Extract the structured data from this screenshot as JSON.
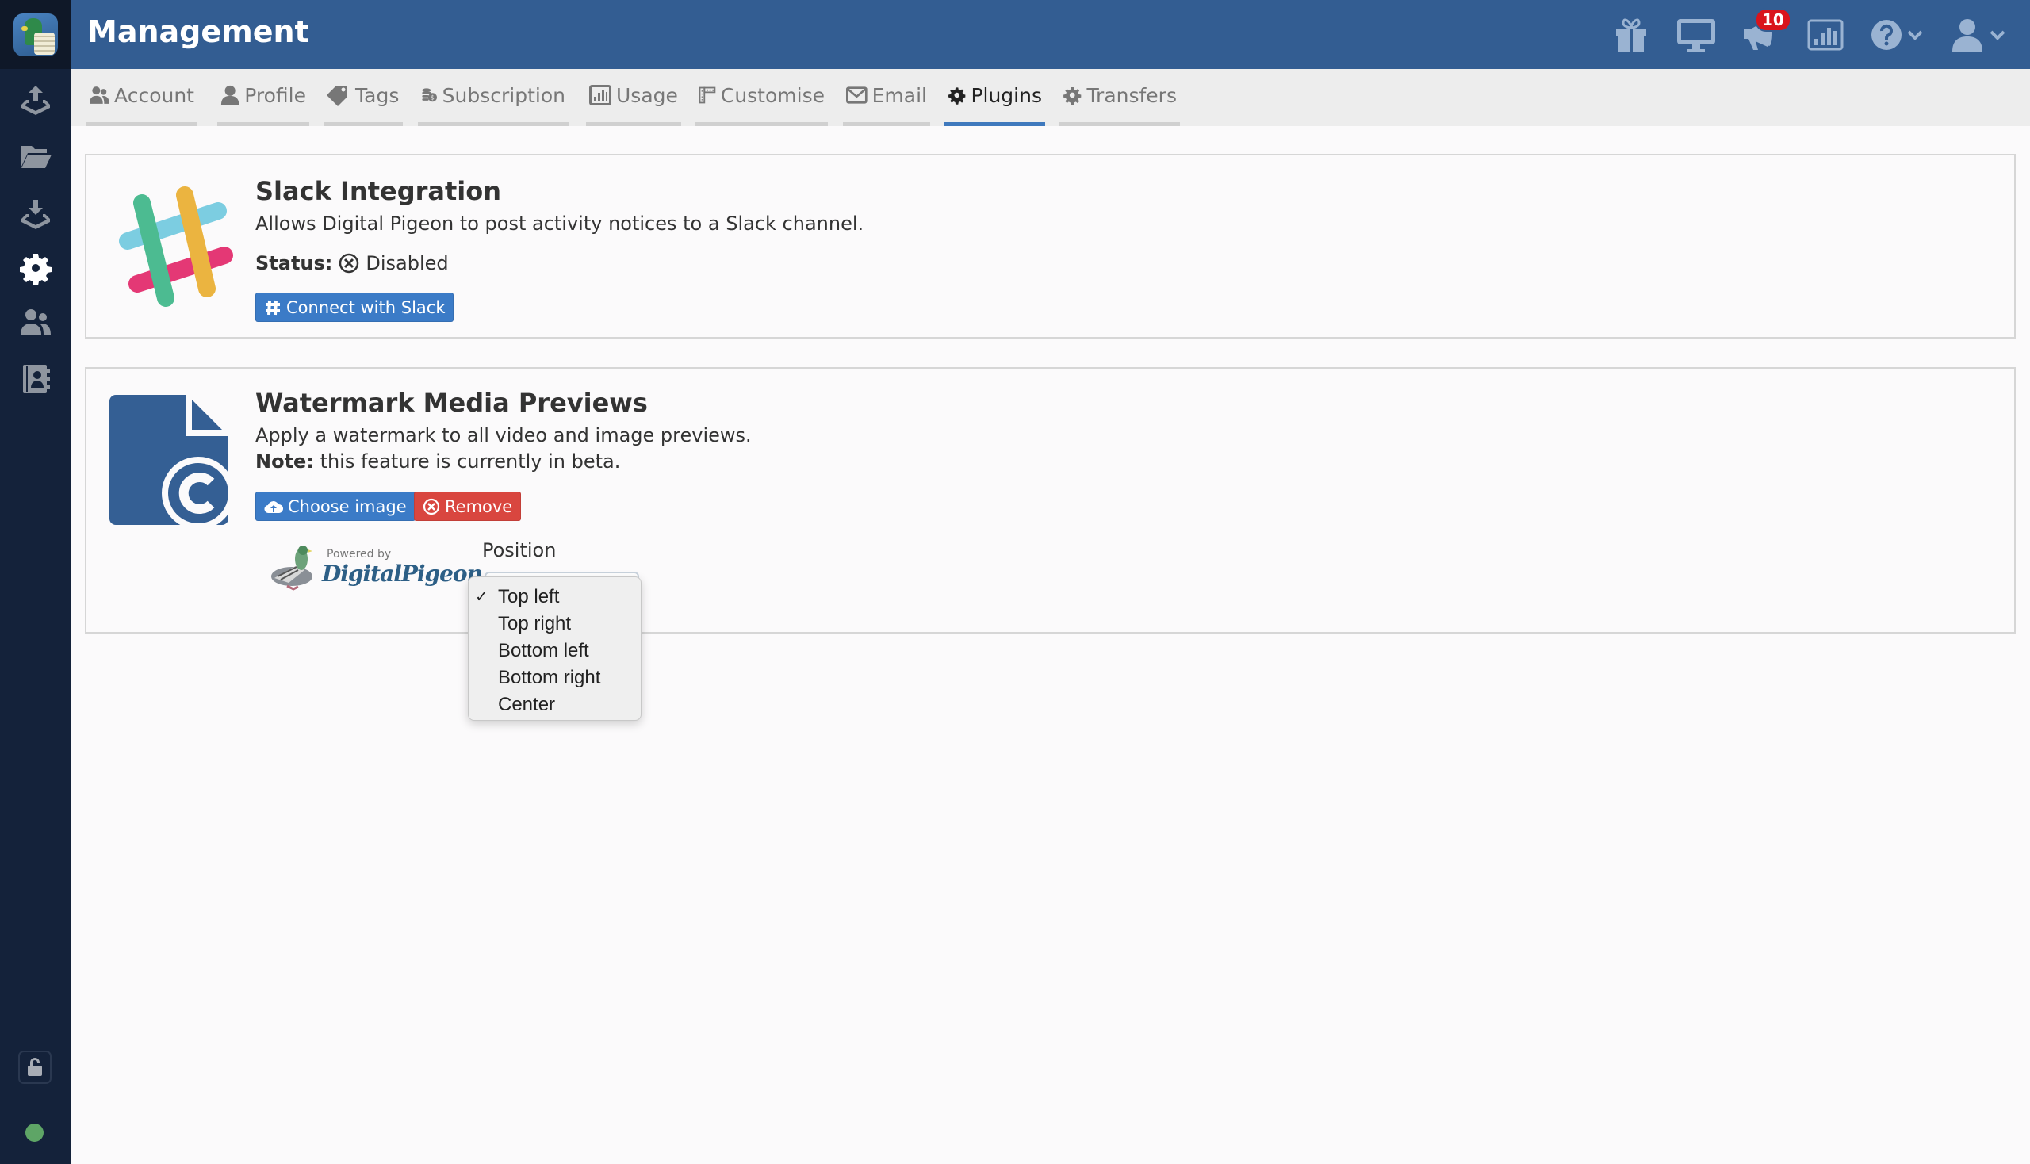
{
  "header": {
    "title": "Management",
    "notifications_count": "10",
    "icons": [
      "gift-icon",
      "monitor-icon",
      "megaphone-icon",
      "bar-chart-icon",
      "help-icon",
      "user-icon"
    ]
  },
  "sidebar": {
    "items": [
      {
        "name": "upload",
        "icon": "upload-tray-icon",
        "active": false
      },
      {
        "name": "files",
        "icon": "folder-open-icon",
        "active": false
      },
      {
        "name": "download",
        "icon": "download-tray-icon",
        "active": false
      },
      {
        "name": "settings",
        "icon": "gear-icon",
        "active": true
      },
      {
        "name": "users",
        "icon": "users-icon",
        "active": false
      },
      {
        "name": "contacts",
        "icon": "address-book-icon",
        "active": false
      }
    ],
    "lock_state": "unlocked",
    "status_color": "#5ea566"
  },
  "tabs": [
    {
      "label": "Account",
      "icon": "users-icon",
      "active": false
    },
    {
      "label": "Profile",
      "icon": "user-icon",
      "active": false
    },
    {
      "label": "Tags",
      "icon": "tag-icon",
      "active": false
    },
    {
      "label": "Subscription",
      "icon": "coins-icon",
      "active": false
    },
    {
      "label": "Usage",
      "icon": "bar-chart-icon",
      "active": false
    },
    {
      "label": "Customise",
      "icon": "ruler-icon",
      "active": false
    },
    {
      "label": "Email",
      "icon": "envelope-icon",
      "active": false
    },
    {
      "label": "Plugins",
      "icon": "gear-icon",
      "active": true
    },
    {
      "label": "Transfers",
      "icon": "gear-icon",
      "active": false
    }
  ],
  "plugins": {
    "slack": {
      "title": "Slack Integration",
      "description": "Allows Digital Pigeon to post activity notices to a Slack channel.",
      "status_label": "Status:",
      "status_value": "Disabled",
      "connect_label": "Connect with Slack"
    },
    "watermark": {
      "title": "Watermark Media Previews",
      "description": "Apply a watermark to all video and image previews.",
      "note_label": "Note:",
      "note_text": "this feature is currently in beta.",
      "choose_label": "Choose image",
      "remove_label": "Remove",
      "preview_powered": "Powered by",
      "preview_brand": "DigitalPigeon",
      "position_label": "Position",
      "position_options": [
        "Top left",
        "Top right",
        "Bottom left",
        "Bottom right",
        "Center"
      ],
      "position_selected": "Top left"
    }
  },
  "colors": {
    "header": "#335d92",
    "sidebar": "#14223a",
    "primary_button": "#3b7bc7",
    "danger_button": "#d9463f",
    "active_tab": "#3f79bd",
    "badge": "#d9141c"
  }
}
